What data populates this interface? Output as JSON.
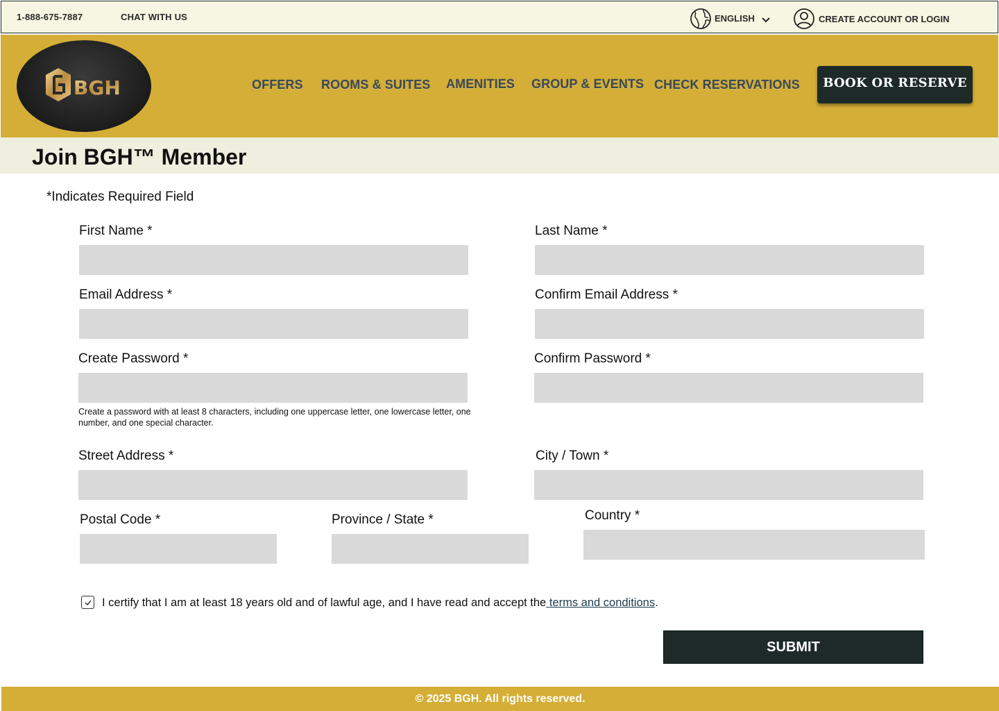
{
  "topbar": {
    "phone": "1-888-675-7887",
    "chat": "CHAT WITH US",
    "language": "ENGLISH",
    "account": "CREATE ACCOUNT OR LOGIN"
  },
  "header": {
    "logo_text": "BGH",
    "nav": [
      "OFFERS",
      "ROOMS & SUITES",
      "AMENITIES",
      "GROUP & EVENTS",
      "CHECK RESERVATIONS"
    ],
    "book_button": "BOOK OR RESERVE"
  },
  "page": {
    "title": "Join BGH™ Member",
    "required_note": "*Indicates Required Field"
  },
  "form": {
    "first_name": "First Name *",
    "last_name": "Last Name *",
    "email": "Email Address *",
    "confirm_email": "Confirm Email Address *",
    "password": "Create Password *",
    "confirm_password": "Confirm Password *",
    "password_hint": "Create a password with at least 8 characters, including one uppercase letter, one lowercase letter, one number, and one special character.",
    "street": "Street Address *",
    "city": "City / Town *",
    "postal": "Postal Code *",
    "province": "Province / State *",
    "country": "Country *",
    "certify_text": "I certify that I am at least 18 years old and of lawful age, and I have read and accept the",
    "terms_link": " terms and conditions",
    "certify_end": ".",
    "certify_checked": true,
    "submit": "SUBMIT"
  },
  "footer": {
    "copyright": "© 2025 BGH. All rights reserved."
  },
  "colors": {
    "gold": "#d4ae36",
    "dark": "#1d2a28",
    "cream": "#f6f6e2",
    "field": "#d9d9d9"
  }
}
